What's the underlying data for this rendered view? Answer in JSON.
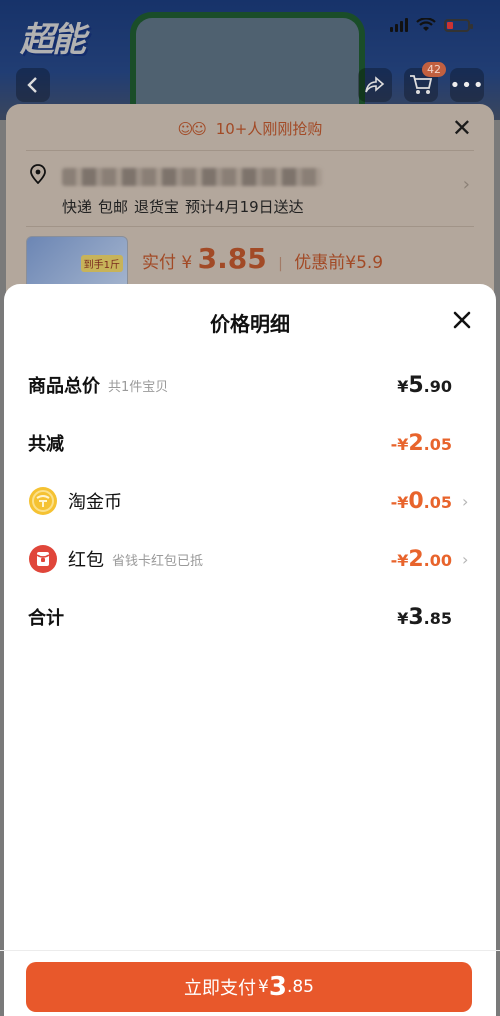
{
  "background": {
    "brand_logo": "超能",
    "status": {
      "signal_bars": 4,
      "battery_icon": "battery-low-charging-icon"
    },
    "cart_count": "42",
    "rush_text": "10+人刚刚抢购",
    "shipping": [
      "快递",
      "包邮",
      "退货宝",
      "预计4月19日送达"
    ],
    "thumb_tag": "到手1斤",
    "paid_label": "实付",
    "paid_symbol": "¥",
    "paid_amount": "3.85",
    "before_discount": "优惠前¥5.9"
  },
  "sheet": {
    "title": "价格明细",
    "rows": [
      {
        "label": "商品总价",
        "sub": "共1件宝贝",
        "sym": "¥",
        "int": "5",
        "dec": ".90",
        "style": "dark"
      },
      {
        "label": "共减",
        "sub": "",
        "sym": "-¥",
        "int": "2",
        "dec": ".05",
        "style": "orange"
      },
      {
        "label": "淘金币",
        "sub": "",
        "sym": "-¥",
        "int": "0",
        "dec": ".05",
        "style": "orange",
        "icon": "gold-coin-icon"
      },
      {
        "label": "红包",
        "sub": "省钱卡红包已抵",
        "sym": "-¥",
        "int": "2",
        "dec": ".00",
        "style": "orange",
        "icon": "red-envelope-icon"
      },
      {
        "label": "合计",
        "sub": "",
        "sym": "¥",
        "int": "3",
        "dec": ".85",
        "style": "dark"
      }
    ]
  },
  "pay_button": {
    "label": "立即支付",
    "sym": "¥",
    "int": "3",
    "dec": ".85"
  },
  "colors": {
    "accent": "#e8582b",
    "discount": "#e8642c",
    "coin": "#f5c232",
    "envelope": "#e0463a"
  }
}
